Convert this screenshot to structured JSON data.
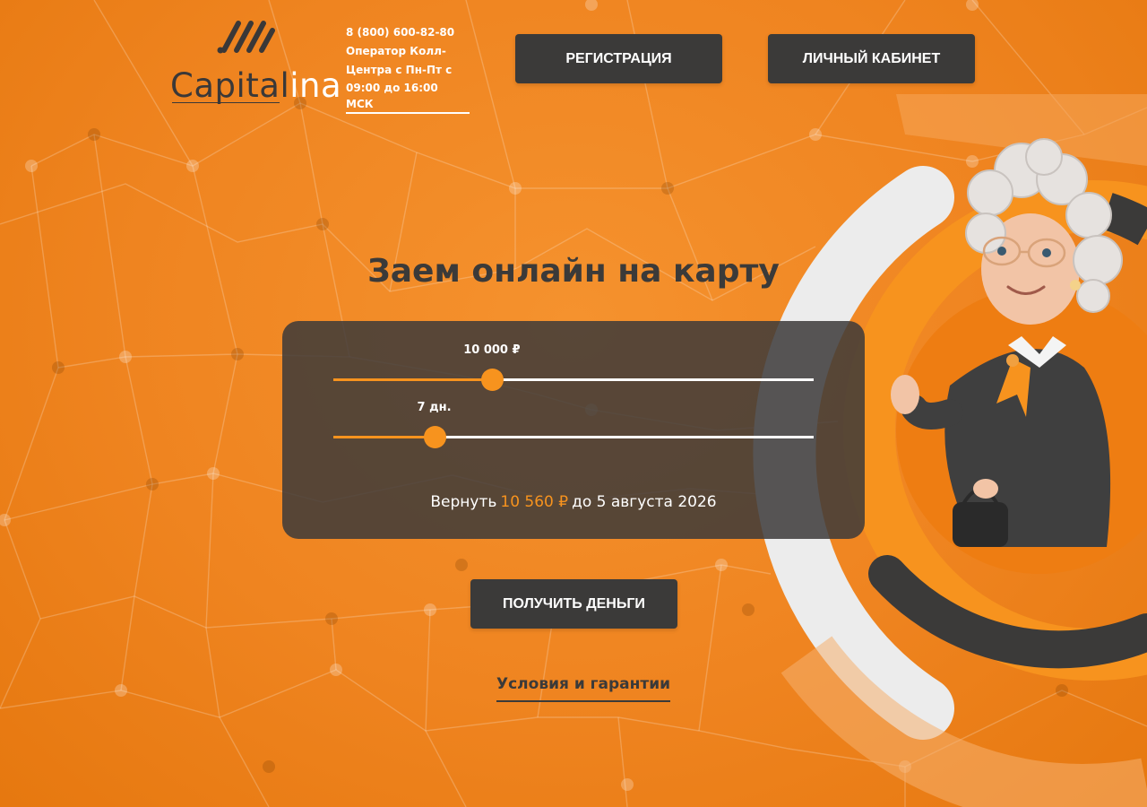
{
  "header": {
    "logo": {
      "part1": "Capital",
      "part2": "ina"
    },
    "phone": "8 (800) 600-82-80",
    "operator_line1": "Оператор Колл-",
    "operator_line2": "Центра с Пн-Пт с",
    "hours": "09:00 до 16:00 МСК",
    "register_label": "РЕГИСТРАЦИЯ",
    "cabinet_label": "ЛИЧНЫЙ КАБИНЕТ"
  },
  "hero": {
    "title": "Заем онлайн на карту"
  },
  "calculator": {
    "sum": {
      "label": "10 000 ₽",
      "value": 10000,
      "fraction": 0.33
    },
    "days": {
      "label": "7 дн.",
      "value": 7,
      "fraction": 0.21
    },
    "summary_prefix": "Вернуть",
    "summary_amount": "10 560 ₽",
    "summary_suffix": "до 5 августа 2026"
  },
  "cta": {
    "get_money_label": "ПОЛУЧИТЬ ДЕНЬГИ"
  },
  "links": {
    "terms_label": "Условия и гарантии"
  },
  "colors": {
    "accent": "#f7931e",
    "dark": "#3b3a39",
    "background": "#ef8420"
  }
}
